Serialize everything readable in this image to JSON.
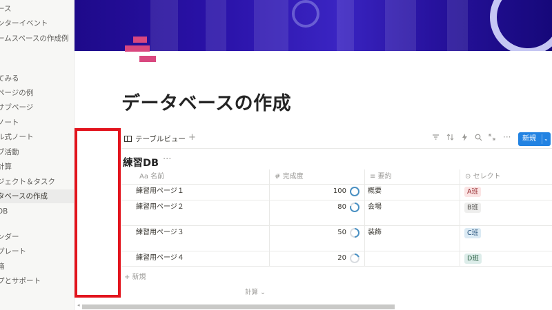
{
  "sidebar": {
    "items": [
      {
        "label": "ース",
        "top": 0
      },
      {
        "label": "ンターイベント",
        "top": 0
      },
      {
        "label": "ームスペースの作成例",
        "top": 0
      },
      {
        "label": "",
        "top": 0
      },
      {
        "label": "てみる",
        "top": 0
      },
      {
        "label": "ページの例",
        "top": 0
      },
      {
        "label": "サブページ",
        "top": 0
      },
      {
        "label": "ノート",
        "top": 0
      },
      {
        "label": "ル式ノート",
        "top": 0
      },
      {
        "label": "ブ活動",
        "top": 0
      },
      {
        "label": "計算",
        "top": 0
      },
      {
        "label": "ジェクト＆タスク",
        "top": 0
      },
      {
        "label": "タベースの作成",
        "top": 0
      },
      {
        "label": "DB",
        "top": 0
      },
      {
        "label": "",
        "top": 0
      },
      {
        "label": "ンダー",
        "top": 0
      },
      {
        "label": "プレート",
        "top": 0
      },
      {
        "label": "箱",
        "top": 0
      },
      {
        "label": "プとサポート",
        "top": 0
      }
    ]
  },
  "page": {
    "title": "データベースの作成"
  },
  "view": {
    "tab_label": "テーブルビュー",
    "add": "+",
    "new_button": "新規",
    "chevron": "⌄"
  },
  "database": {
    "title": "練習DB",
    "more": "···",
    "columns": [
      {
        "label": "名前",
        "icon": "Aa"
      },
      {
        "label": "完成度",
        "icon": "#"
      },
      {
        "label": "要約",
        "icon": "≡"
      },
      {
        "label": "セレクト",
        "icon": "⊙"
      }
    ],
    "rows": [
      {
        "name": "練習用ページ１",
        "progress": "100",
        "progress_value": 1.0,
        "summary": "概要",
        "select": "A班",
        "select_color": "#fbe4e4",
        "select_text": "#93262a"
      },
      {
        "name": "練習用ページ２",
        "progress": "80",
        "progress_value": 0.8,
        "summary": "会場",
        "select": "B班",
        "select_color": "#eeeeed",
        "select_text": "#44423d"
      },
      {
        "name": "練習用ページ３",
        "progress": "50",
        "progress_value": 0.5,
        "summary": "装飾",
        "select": "C班",
        "select_color": "#dbeaf4",
        "select_text": "#24507a"
      },
      {
        "name": "練習用ページ４",
        "progress": "20",
        "progress_value": 0.2,
        "summary": "",
        "select": "D班",
        "select_color": "#ddedea",
        "select_text": "#235a3c"
      }
    ],
    "add_row": "+ 新規",
    "calculate": "計算 ⌄"
  },
  "colors": {
    "accent": "#2383e2",
    "highlight_box": "#e2141d",
    "ring": "#4a90c2"
  }
}
